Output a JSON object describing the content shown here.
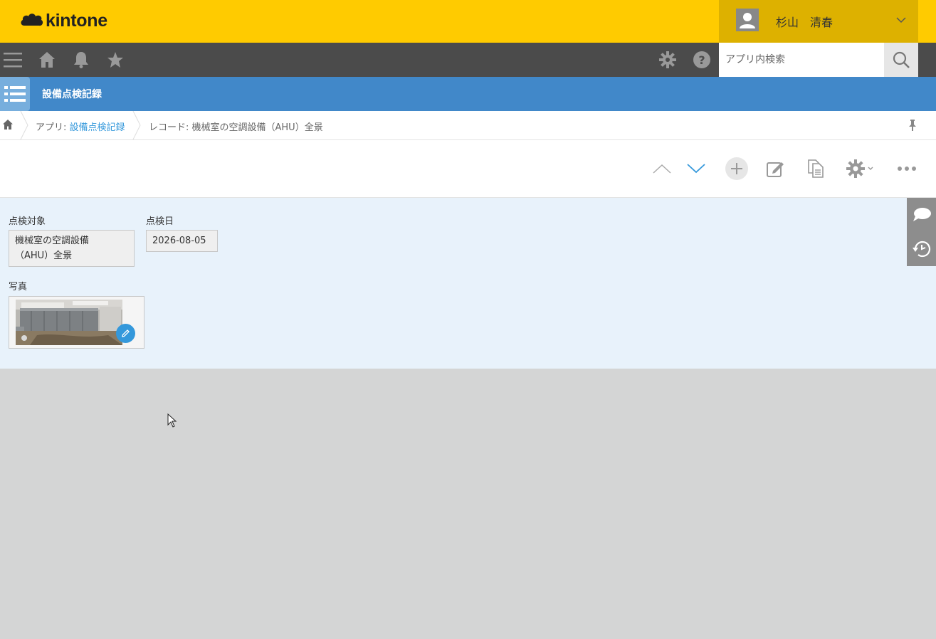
{
  "header": {
    "logo_text": "kintone",
    "user_name": "杉山　清春"
  },
  "navbar": {
    "search_placeholder": "アプリ内検索"
  },
  "app": {
    "title": "設備点検記録"
  },
  "breadcrumb": {
    "app_prefix": "アプリ: ",
    "app_link": "設備点検記録",
    "record_label": "レコード: 機械室の空調設備（AHU）全景"
  },
  "record": {
    "fields": {
      "target": {
        "label": "点検対象",
        "value_line1": "機械室の空調設備",
        "value_line2": "（AHU）全景"
      },
      "date": {
        "label": "点検日",
        "value": "2026-08-05"
      },
      "photo": {
        "label": "写真"
      }
    }
  },
  "colors": {
    "header_bg": "#ffcb00",
    "navbar_bg": "#4b4b4b",
    "appbar_bg": "#4188c9",
    "record_bg": "#e8f2fb",
    "link": "#3498db"
  }
}
